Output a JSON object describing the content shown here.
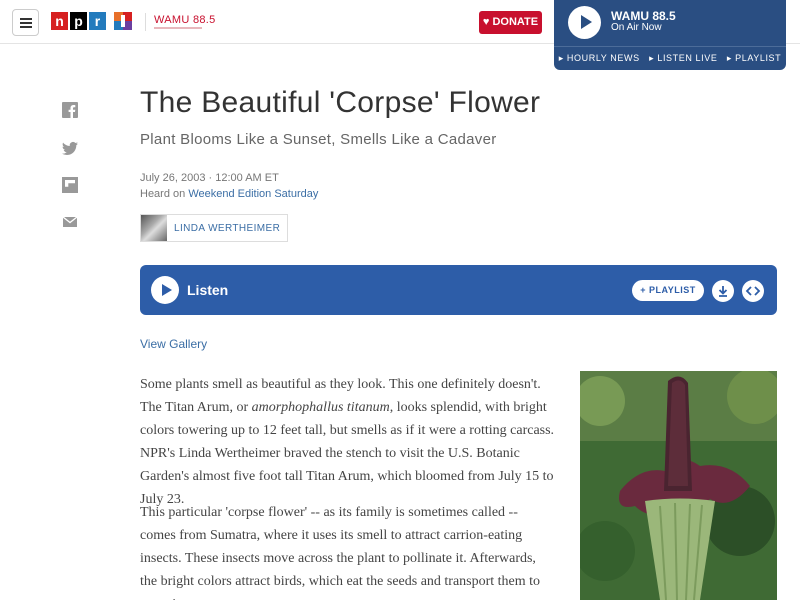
{
  "header": {
    "menu_icon": "hamburger-icon",
    "logo_letters": [
      "n",
      "p",
      "r"
    ],
    "station_logo": "WAMU 88.5",
    "donate_label": "DONATE",
    "donate_icon": "heart-icon"
  },
  "live_player": {
    "station": "WAMU 88.5",
    "status": "On Air Now",
    "links": [
      "HOURLY NEWS",
      "LISTEN LIVE",
      "PLAYLIST"
    ]
  },
  "share_icons": [
    "facebook-icon",
    "twitter-icon",
    "flipboard-icon",
    "email-icon"
  ],
  "article": {
    "title": "The Beautiful 'Corpse' Flower",
    "subtitle": "Plant Blooms Like a Sunset, Smells Like a Cadaver",
    "dateline": "July 26, 2003 · 12:00 AM ET",
    "heard_prefix": "Heard on ",
    "heard_show": "Weekend Edition Saturday",
    "byline": "LINDA WERTHEIMER",
    "view_gallery": "View Gallery",
    "paragraph1_a": "Some plants smell as beautiful as they look. This one definitely doesn't. The Titan Arum, or ",
    "paragraph1_em": "amorphophallus titanum",
    "paragraph1_b": ", looks splendid, with bright colors towering up to 12 feet tall, but smells as if it were a rotting carcass. NPR's Linda Wertheimer braved the stench to visit the U.S. Botanic Garden's almost five foot tall Titan Arum, which bloomed from July 15 to July 23.",
    "paragraph2": "This particular 'corpse flower' -- as its family is sometimes called -- comes from Sumatra, where it uses its smell to attract carrion-eating insects. These insects move across the plant to pollinate it. Afterwards, the bright colors attract birds, which eat the seeds and transport them to new sites."
  },
  "audio": {
    "listen_label": "Listen",
    "playlist_label": "PLAYLIST",
    "download_icon": "download-icon",
    "embed_icon": "embed-icon"
  },
  "colors": {
    "npr_red": "#d62021",
    "npr_blue": "#237bbd",
    "donate_red": "#c8102e",
    "player_blue": "#2d5da8",
    "live_navy": "#2a4e82",
    "link_blue": "#3b6ea5"
  }
}
